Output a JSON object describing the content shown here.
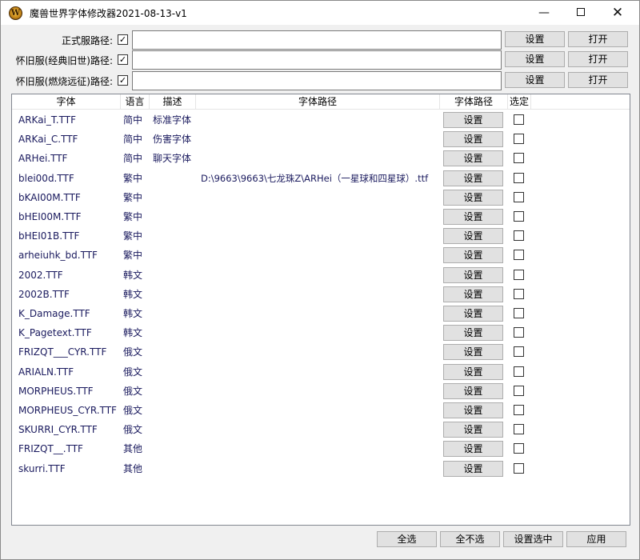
{
  "window": {
    "title": "魔兽世界字体修改器2021-08-13-v1",
    "app_icon_letter": "W",
    "minimize": "—",
    "close": "✕"
  },
  "paths": [
    {
      "label": "正式服路径:",
      "checked": true,
      "value": "",
      "set_label": "设置",
      "open_label": "打开"
    },
    {
      "label": "怀旧服(经典旧世)路径:",
      "checked": true,
      "value": "",
      "set_label": "设置",
      "open_label": "打开"
    },
    {
      "label": "怀旧服(燃烧远征)路径:",
      "checked": true,
      "value": "",
      "set_label": "设置",
      "open_label": "打开"
    }
  ],
  "table": {
    "headers": [
      "字体",
      "语言",
      "描述",
      "字体路径",
      "字体路径",
      "选定"
    ],
    "rows": [
      {
        "font": "ARKai_T.TTF",
        "lang": "简中",
        "desc": "标准字体",
        "path": "",
        "btn": "设置",
        "checked": false
      },
      {
        "font": "ARKai_C.TTF",
        "lang": "简中",
        "desc": "伤害字体",
        "path": "",
        "btn": "设置",
        "checked": false
      },
      {
        "font": "ARHei.TTF",
        "lang": "简中",
        "desc": "聊天字体",
        "path": "",
        "btn": "设置",
        "checked": false
      },
      {
        "font": "blei00d.TTF",
        "lang": "繁中",
        "desc": "",
        "path": "D:\\9663\\9663\\七龙珠Z\\ARHei（一星球和四星球）.ttf",
        "btn": "设置",
        "checked": false
      },
      {
        "font": "bKAI00M.TTF",
        "lang": "繁中",
        "desc": "",
        "path": "",
        "btn": "设置",
        "checked": false
      },
      {
        "font": "bHEI00M.TTF",
        "lang": "繁中",
        "desc": "",
        "path": "",
        "btn": "设置",
        "checked": false
      },
      {
        "font": "bHEI01B.TTF",
        "lang": "繁中",
        "desc": "",
        "path": "",
        "btn": "设置",
        "checked": false
      },
      {
        "font": "arheiuhk_bd.TTF",
        "lang": "繁中",
        "desc": "",
        "path": "",
        "btn": "设置",
        "checked": false
      },
      {
        "font": "2002.TTF",
        "lang": "韩文",
        "desc": "",
        "path": "",
        "btn": "设置",
        "checked": false
      },
      {
        "font": "2002B.TTF",
        "lang": "韩文",
        "desc": "",
        "path": "",
        "btn": "设置",
        "checked": false
      },
      {
        "font": "K_Damage.TTF",
        "lang": "韩文",
        "desc": "",
        "path": "",
        "btn": "设置",
        "checked": false
      },
      {
        "font": "K_Pagetext.TTF",
        "lang": "韩文",
        "desc": "",
        "path": "",
        "btn": "设置",
        "checked": false
      },
      {
        "font": "FRIZQT___CYR.TTF",
        "lang": "俄文",
        "desc": "",
        "path": "",
        "btn": "设置",
        "checked": false
      },
      {
        "font": "ARIALN.TTF",
        "lang": "俄文",
        "desc": "",
        "path": "",
        "btn": "设置",
        "checked": false
      },
      {
        "font": "MORPHEUS.TTF",
        "lang": "俄文",
        "desc": "",
        "path": "",
        "btn": "设置",
        "checked": false
      },
      {
        "font": "MORPHEUS_CYR.TTF",
        "lang": "俄文",
        "desc": "",
        "path": "",
        "btn": "设置",
        "checked": false
      },
      {
        "font": "SKURRI_CYR.TTF",
        "lang": "俄文",
        "desc": "",
        "path": "",
        "btn": "设置",
        "checked": false
      },
      {
        "font": "FRIZQT__.TTF",
        "lang": "其他",
        "desc": "",
        "path": "",
        "btn": "设置",
        "checked": false
      },
      {
        "font": "skurri.TTF",
        "lang": "其他",
        "desc": "",
        "path": "",
        "btn": "设置",
        "checked": false
      }
    ]
  },
  "footer": {
    "select_all": "全选",
    "select_none": "全不选",
    "set_selected": "设置选中",
    "apply": "应用"
  },
  "colors": {
    "window_bg": "#f0f0f0",
    "button_bg": "#e1e1e1",
    "row_text": "#1a1a5e"
  },
  "icons": {
    "app": "wow-logo-icon",
    "minimize": "minimize-icon",
    "maximize": "maximize-icon",
    "close": "close-icon",
    "check": "checkmark-icon"
  }
}
